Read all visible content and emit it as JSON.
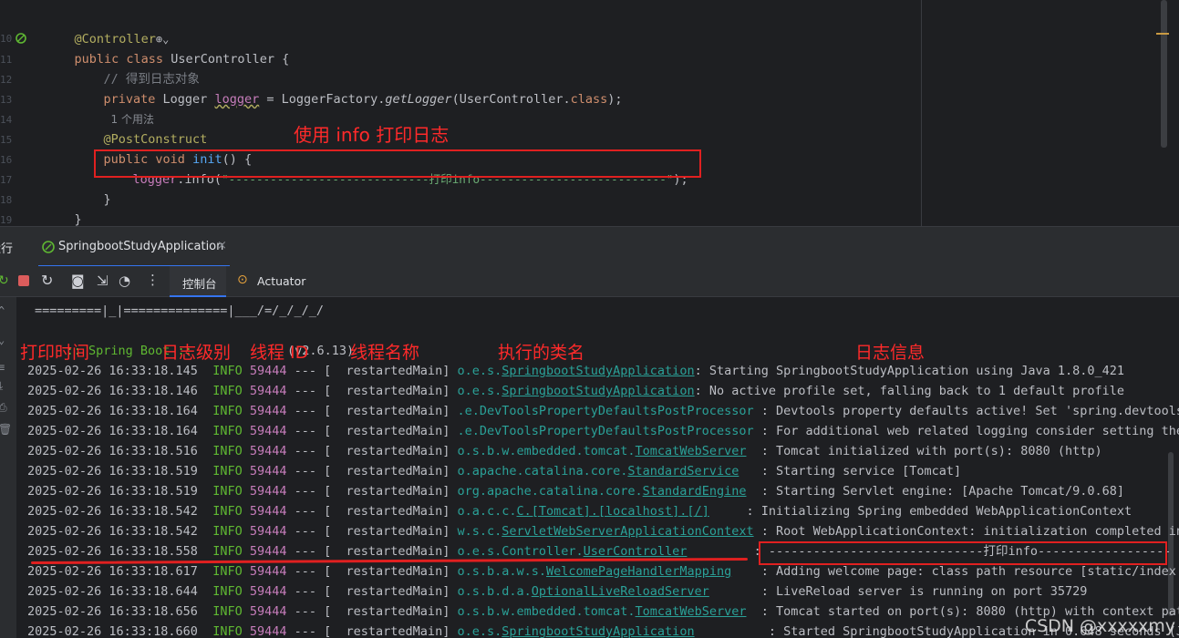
{
  "editor": {
    "gutter": [
      "10",
      "11",
      "12",
      "13",
      "14",
      "15",
      "16",
      "17",
      "18",
      "19"
    ],
    "lines": {
      "l9_annotation": "@Controller",
      "l10_public": "public class ",
      "l10_name": "UserController {",
      "l11_comment": "// 得到日志对象",
      "l12_private": "private ",
      "l12_type": "Logger ",
      "l12_field": "logger",
      "l12_eq": " = LoggerFactory.",
      "l12_method": "getLogger",
      "l12_arg": "(UserController.",
      "l12_class": "class",
      "l12_end": ");",
      "l12_hint": "1 个用法",
      "l14_annotation": "@PostConstruct",
      "l15_public": "public void ",
      "l15_method": "init",
      "l15_end": "() {",
      "l16_field": "logger",
      "l16_call": ".info(",
      "l16_string": "\"-----------------------------打印info---------------------------\"",
      "l16_end": ");",
      "l17_brace": "}",
      "l18_brace": "}"
    },
    "annotation_label": "使用 info 打印日志"
  },
  "toolwindow": {
    "run_label": "运行",
    "tab_title": "SpringbootStudyApplication",
    "tab_console": "控制台",
    "tab_actuator": "Actuator"
  },
  "console": {
    "banner1": "=========|_|==============|___/=/_/_/_/",
    "banner2_label": " :: Spring Boot :: ",
    "banner2_version": "(v2.6.13)",
    "headers": {
      "time": "打印时间",
      "level": "日志级别",
      "thread_id": "线程 ID",
      "thread_name": "线程名称",
      "class": "执行的类名",
      "message": "日志信息"
    },
    "rows": [
      {
        "ts": "2025-02-26 16:33:18.145",
        "lvl": "INFO",
        "pid": "59444",
        "thread": "restartedMain",
        "pkg": "o.e.s.",
        "cls": "SpringbootStudyApplication",
        "pad": "          ",
        "msg": ": Starting SpringbootStudyApplication using Java 1.8.0_421"
      },
      {
        "ts": "2025-02-26 16:33:18.146",
        "lvl": "INFO",
        "pid": "59444",
        "thread": "restartedMain",
        "pkg": "o.e.s.",
        "cls": "SpringbootStudyApplication",
        "pad": "          ",
        "msg": ": No active profile set, falling back to 1 default profile"
      },
      {
        "ts": "2025-02-26 16:33:18.164",
        "lvl": "INFO",
        "pid": "59444",
        "thread": "restartedMain",
        "pkg": ".e.DevToolsPropertyDefaultsPostProcessor",
        "cls": "",
        "pad": "",
        "msg": " : Devtools property defaults active! Set 'spring.devtools."
      },
      {
        "ts": "2025-02-26 16:33:18.164",
        "lvl": "INFO",
        "pid": "59444",
        "thread": "restartedMain",
        "pkg": ".e.DevToolsPropertyDefaultsPostProcessor",
        "cls": "",
        "pad": "",
        "msg": " : For additional web related logging consider setting the"
      },
      {
        "ts": "2025-02-26 16:33:18.516",
        "lvl": "INFO",
        "pid": "59444",
        "thread": "restartedMain",
        "pkg": "o.s.b.w.embedded.tomcat.",
        "cls": "TomcatWebServer",
        "pad": "",
        "msg": "  : Tomcat initialized with port(s): 8080 (http)"
      },
      {
        "ts": "2025-02-26 16:33:18.519",
        "lvl": "INFO",
        "pid": "59444",
        "thread": "restartedMain",
        "pkg": "o.apache.catalina.core.",
        "cls": "StandardService",
        "pad": "",
        "msg": "   : Starting service [Tomcat]"
      },
      {
        "ts": "2025-02-26 16:33:18.519",
        "lvl": "INFO",
        "pid": "59444",
        "thread": "restartedMain",
        "pkg": "org.apache.catalina.core.",
        "cls": "StandardEngine",
        "pad": "",
        "msg": "  : Starting Servlet engine: [Apache Tomcat/9.0.68]"
      },
      {
        "ts": "2025-02-26 16:33:18.542",
        "lvl": "INFO",
        "pid": "59444",
        "thread": "restartedMain",
        "pkg": "o.a.c.c.",
        "cls": "C.[Tomcat].[localhost].[/]",
        "pad": "",
        "msg": "     : Initializing Spring embedded WebApplicationContext"
      },
      {
        "ts": "2025-02-26 16:33:18.542",
        "lvl": "INFO",
        "pid": "59444",
        "thread": "restartedMain",
        "pkg": "w.s.c.",
        "cls": "ServletWebServerApplicationContext",
        "pad": "",
        "msg": " : Root WebApplicationContext: initialization completed in"
      },
      {
        "ts": "2025-02-26 16:33:18.558",
        "lvl": "INFO",
        "pid": "59444",
        "thread": "restartedMain",
        "pkg": "o.e.s.Controller.",
        "cls": "UserController",
        "pad": "",
        "msg": "         : -----------------------------打印info------------------"
      },
      {
        "ts": "2025-02-26 16:33:18.617",
        "lvl": "INFO",
        "pid": "59444",
        "thread": "restartedMain",
        "pkg": "o.s.b.a.w.s.",
        "cls": "WelcomePageHandlerMapping",
        "pad": "",
        "msg": "    : Adding welcome page: class path resource [static/index.h"
      },
      {
        "ts": "2025-02-26 16:33:18.644",
        "lvl": "INFO",
        "pid": "59444",
        "thread": "restartedMain",
        "pkg": "o.s.b.d.a.",
        "cls": "OptionalLiveReloadServer",
        "pad": "",
        "msg": "       : LiveReload server is running on port 35729"
      },
      {
        "ts": "2025-02-26 16:33:18.656",
        "lvl": "INFO",
        "pid": "59444",
        "thread": "restartedMain",
        "pkg": "o.s.b.w.embedded.tomcat.",
        "cls": "TomcatWebServer",
        "pad": "",
        "msg": "  : Tomcat started on port(s): 8080 (http) with context path"
      },
      {
        "ts": "2025-02-26 16:33:18.660",
        "lvl": "INFO",
        "pid": "59444",
        "thread": "restartedMain",
        "pkg": "o.e.s.",
        "cls": "SpringbootStudyApplication",
        "pad": "",
        "msg": "          : Started SpringbootStudyApplication in 0.648 seconds (JVM"
      }
    ],
    "watermark": "CSDN @xxxxxmy"
  }
}
